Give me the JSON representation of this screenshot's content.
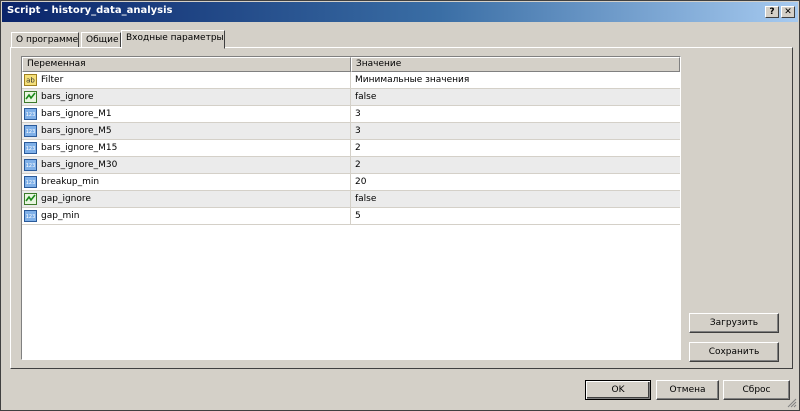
{
  "window": {
    "title": "Script - history_data_analysis",
    "help_glyph": "?",
    "close_glyph": "✕"
  },
  "tabs": [
    {
      "label": "О программе"
    },
    {
      "label": "Общие"
    },
    {
      "label": "Входные параметры",
      "active": true
    }
  ],
  "grid": {
    "columns": [
      "Переменная",
      "Значение"
    ],
    "rows": [
      {
        "icon": "string-icon",
        "icon_text": "ab",
        "name": "Filter",
        "value": "Минимальные значения"
      },
      {
        "icon": "bool-icon",
        "name": "bars_ignore",
        "value": "false"
      },
      {
        "icon": "int-icon",
        "icon_text": "123",
        "name": "bars_ignore_M1",
        "value": "3"
      },
      {
        "icon": "int-icon",
        "icon_text": "123",
        "name": "bars_ignore_M5",
        "value": "3"
      },
      {
        "icon": "int-icon",
        "icon_text": "123",
        "name": "bars_ignore_M15",
        "value": "2"
      },
      {
        "icon": "int-icon",
        "icon_text": "123",
        "name": "bars_ignore_M30",
        "value": "2"
      },
      {
        "icon": "int-icon",
        "icon_text": "123",
        "name": "breakup_min",
        "value": "20"
      },
      {
        "icon": "bool-icon",
        "name": "gap_ignore",
        "value": "false"
      },
      {
        "icon": "int-icon",
        "icon_text": "123",
        "name": "gap_min",
        "value": "5"
      }
    ]
  },
  "side_buttons": {
    "load": "Загрузить",
    "save": "Сохранить"
  },
  "footer": {
    "ok": "OK",
    "cancel": "Отмена",
    "reset": "Сброс"
  },
  "colors": {
    "titlebar_start": "#0a246a",
    "titlebar_end": "#a6caf0",
    "face": "#d4d0c8"
  }
}
